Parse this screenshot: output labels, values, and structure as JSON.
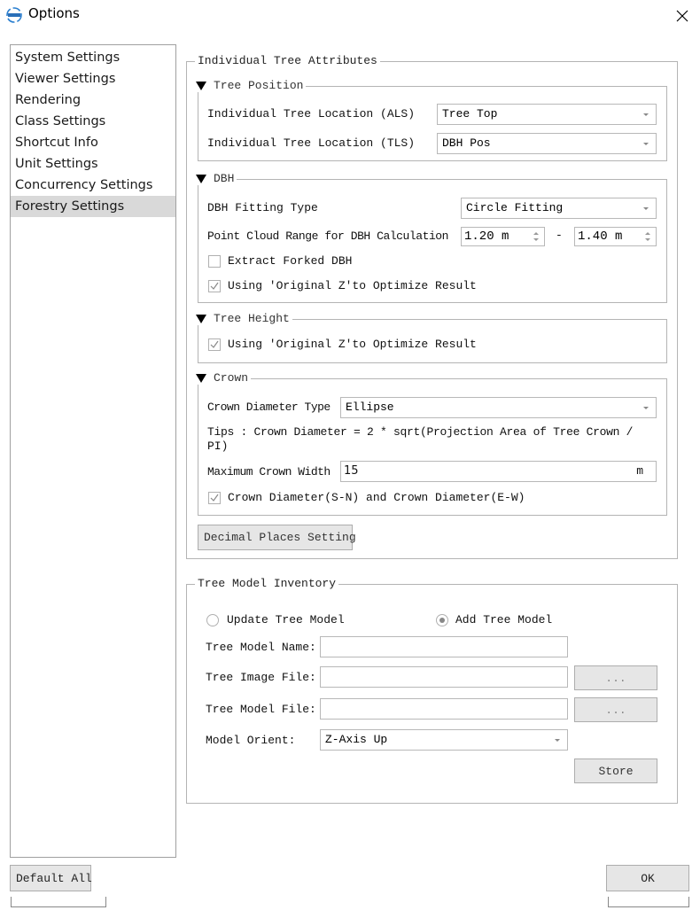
{
  "window": {
    "title": "Options",
    "app_icon": "app-logo-icon",
    "close_icon": "close-icon"
  },
  "sidebar": {
    "items": [
      {
        "label": "System Settings",
        "selected": false
      },
      {
        "label": "Viewer Settings",
        "selected": false
      },
      {
        "label": "Rendering",
        "selected": false
      },
      {
        "label": "Class Settings",
        "selected": false
      },
      {
        "label": "Shortcut Info",
        "selected": false
      },
      {
        "label": "Unit Settings",
        "selected": false
      },
      {
        "label": "Concurrency Settings",
        "selected": false
      },
      {
        "label": "Forestry Settings",
        "selected": true
      }
    ]
  },
  "individual_tree_attributes": {
    "title": "Individual Tree Attributes",
    "tree_position": {
      "title": "Tree Position",
      "als_label": "Individual Tree Location (ALS)",
      "als_value": "Tree Top",
      "tls_label": "Individual Tree Location (TLS)",
      "tls_value": "DBH Pos"
    },
    "dbh": {
      "title": "DBH",
      "fitting_type_label": "DBH Fitting Type",
      "fitting_type_value": "Circle Fitting",
      "range_label": "Point Cloud Range for DBH Calculation",
      "range_min": "1.20 m",
      "range_separator": "-",
      "range_max": "1.40 m",
      "extract_forked_label": "Extract Forked DBH",
      "extract_forked_checked": false,
      "original_z_label": "Using 'Original Z'to Optimize Result",
      "original_z_checked": true
    },
    "tree_height": {
      "title": "Tree Height",
      "original_z_label": "Using 'Original Z'to Optimize Result",
      "original_z_checked": true
    },
    "crown": {
      "title": "Crown",
      "diameter_type_label": "Crown Diameter Type",
      "diameter_type_value": "Ellipse",
      "tips_line1": "Tips : Crown Diameter = 2 * sqrt(Projection Area of Tree Crown /",
      "tips_line2": "PI)",
      "max_width_label": "Maximum Crown Width",
      "max_width_value": "15",
      "max_width_unit": "m",
      "sn_ew_label": "Crown Diameter(S-N) and Crown Diameter(E-W)",
      "sn_ew_checked": true
    },
    "decimal_places_button": "Decimal Places Setting"
  },
  "tree_model_inventory": {
    "title": "Tree Model Inventory",
    "update_radio_label": "Update Tree Model",
    "update_selected": false,
    "add_radio_label": "Add Tree Model",
    "add_selected": true,
    "model_name_label": "Tree Model Name:",
    "model_name_value": "",
    "image_file_label": "Tree Image File:",
    "image_file_value": "",
    "image_browse_label": "...",
    "model_file_label": "Tree Model File:",
    "model_file_value": "",
    "model_browse_label": "...",
    "orient_label": "Model Orient:",
    "orient_value": "Z-Axis Up",
    "store_button": "Store"
  },
  "footer": {
    "default_all_button": "Default All",
    "ok_button": "OK"
  }
}
